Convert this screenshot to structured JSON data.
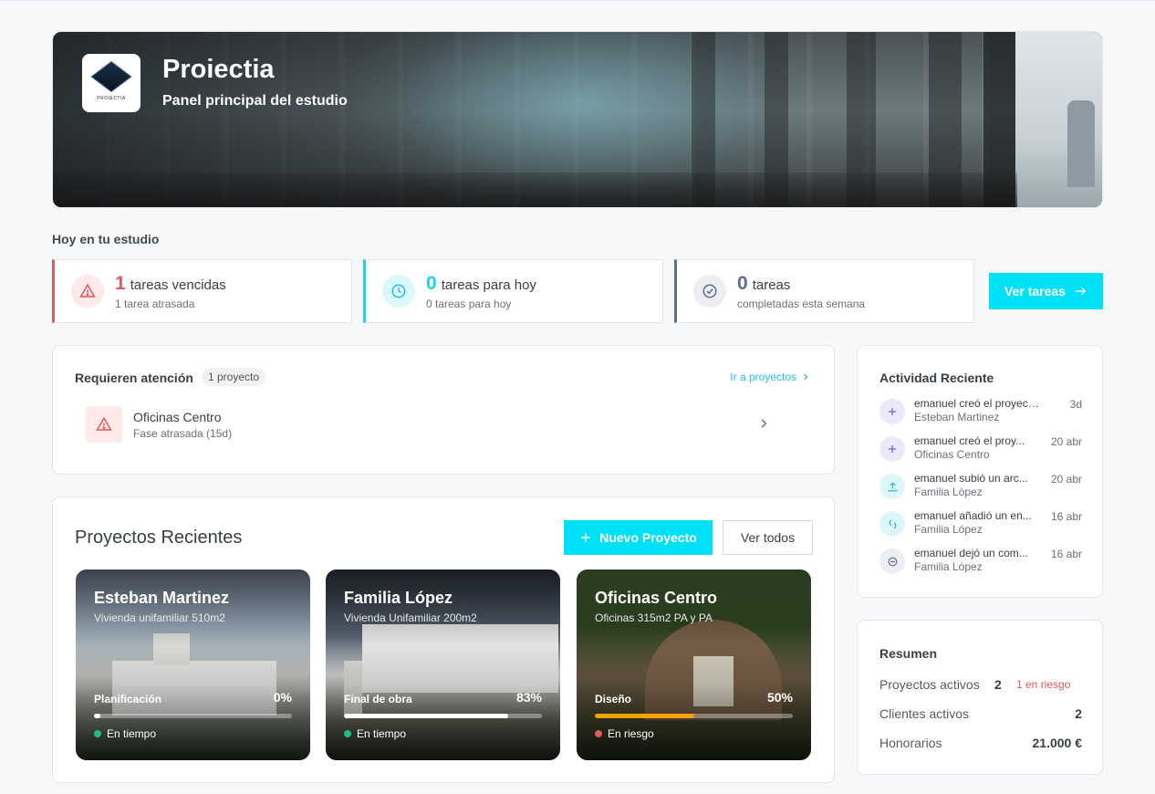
{
  "hero": {
    "title": "Proiectia",
    "subtitle": "Panel principal del estudio",
    "logo_text": "PROIECTIA"
  },
  "today": {
    "label": "Hoy en tu estudio",
    "stats": [
      {
        "value": "1",
        "label": "tareas vencidas",
        "sub": "1 tarea atrasada",
        "color": "#e05a5a",
        "icon": "warning-icon"
      },
      {
        "value": "0",
        "label": "tareas para hoy",
        "sub": "0 tareas para hoy",
        "color": "#19d4f0",
        "icon": "clock-icon"
      },
      {
        "value": "0",
        "label": "tareas",
        "sub": "completadas esta semana",
        "color": "#5b6e8c",
        "icon": "check-circle-icon"
      }
    ],
    "button": "Ver tareas"
  },
  "attention": {
    "title": "Requieren atención",
    "badge": "1 proyecto",
    "link": "Ir a proyectos",
    "items": [
      {
        "name": "Oficinas Centro",
        "sub": "Fase atrasada (15d)"
      }
    ]
  },
  "projects": {
    "title": "Proyectos Recientes",
    "new_button": "Nuevo Proyecto",
    "all_button": "Ver todos",
    "cards": [
      {
        "name": "Esteban Martinez",
        "sub": "Vivienda unifamiliar 510m2",
        "phase": "Planificación",
        "pct": "0%",
        "progress": 0.03,
        "status": "En tiempo",
        "status_color": "#1fbf7a",
        "bar_color": "#ffffff"
      },
      {
        "name": "Familia López",
        "sub": "Vivienda Unifamiliar 200m2",
        "phase": "Final de obra",
        "pct": "83%",
        "progress": 0.83,
        "status": "En tiempo",
        "status_color": "#1fbf7a",
        "bar_color": "#ffffff"
      },
      {
        "name": "Oficinas Centro",
        "sub": "Oficinas 315m2 PA y PA",
        "phase": "Diseño",
        "pct": "50%",
        "progress": 0.5,
        "status": "En riesgo",
        "status_color": "#e05a5a",
        "bar_color": "#f5a200"
      }
    ]
  },
  "activity": {
    "title": "Actividad Reciente",
    "items": [
      {
        "text": "emanuel creó el proyecto...",
        "sub": "Esteban Martinez",
        "time": "3d",
        "icon": "plus-icon"
      },
      {
        "text": "emanuel creó el proy...",
        "sub": "Oficinas Centro",
        "time": "20 abr",
        "icon": "plus-icon"
      },
      {
        "text": "emanuel subió un arc...",
        "sub": "Familia López",
        "time": "20 abr",
        "icon": "upload-icon"
      },
      {
        "text": "emanuel añadió un en...",
        "sub": "Familia López",
        "time": "16 abr",
        "icon": "link-icon"
      },
      {
        "text": "emanuel dejó un com...",
        "sub": "Familia López",
        "time": "16 abr",
        "icon": "comment-icon"
      }
    ]
  },
  "summary": {
    "title": "Resumen",
    "active_projects_label": "Proyectos activos",
    "active_projects_value": "2",
    "risk_label": "1 en riesgo",
    "active_clients_label": "Clientes activos",
    "active_clients_value": "2",
    "fees_label": "Honorarios",
    "fees_value": "21.000 €"
  }
}
